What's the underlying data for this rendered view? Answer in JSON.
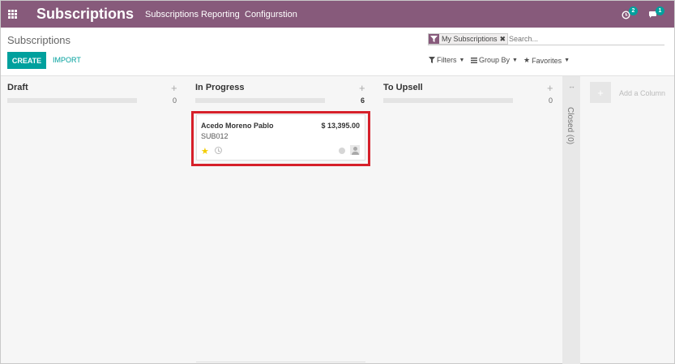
{
  "navbar": {
    "brand": "Subscriptions",
    "menu": [
      "Subscriptions",
      "Reporting",
      "Configurstion"
    ],
    "activity_badge": "2",
    "messages_badge": "1",
    "color": "#875a7b"
  },
  "control_panel": {
    "title": "Subscriptions",
    "search": {
      "facet": "My Subscriptions",
      "placeholder": "Search..."
    },
    "create_label": "CREATE",
    "import_label": "IMPORT",
    "filters_label": "Filters",
    "group_by_label": "Group By",
    "favorites_label": "Favorites"
  },
  "kanban": {
    "columns": [
      {
        "title": "Draft",
        "count": "0"
      },
      {
        "title": "In Progress",
        "count": "6"
      },
      {
        "title": "To Upsell",
        "count": "0"
      }
    ],
    "card": {
      "name": "Acedo Moreno Pablo",
      "amount": "$ 13,395.00",
      "reference": "SUB012"
    },
    "folded_column": "Closed (0)",
    "add_column_label": "Add a Column"
  },
  "colors": {
    "accent": "#00a09d",
    "highlight": "#d6202a",
    "star": "#f3cc00"
  }
}
